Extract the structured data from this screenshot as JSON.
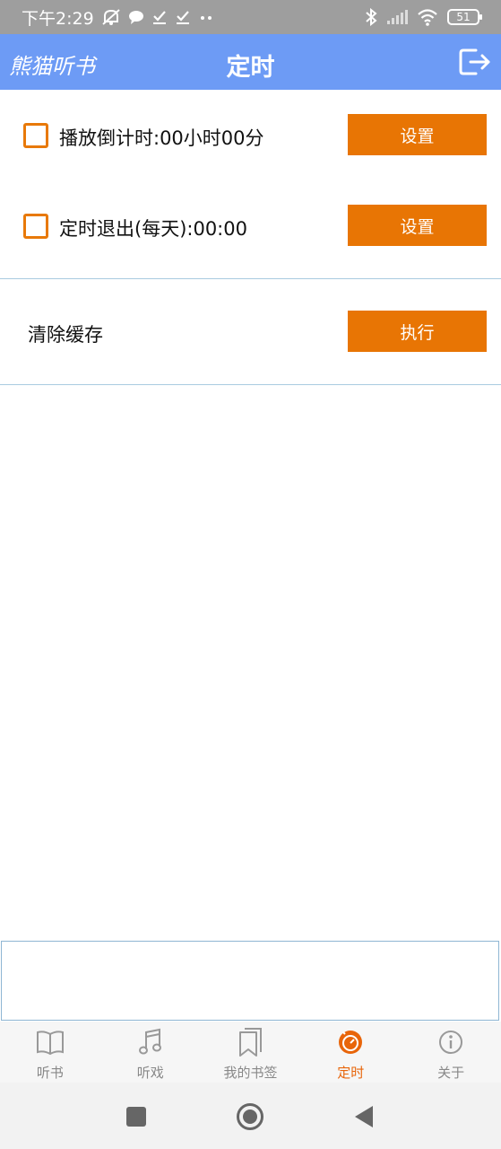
{
  "status_bar": {
    "time": "下午2:29",
    "battery": "51",
    "icons": [
      "mute-icon",
      "chat-bubble-icon",
      "download-done-icon",
      "download-done-icon",
      "more-dots-icon",
      "bluetooth-icon",
      "signal-icon",
      "wifi-icon",
      "battery-icon"
    ]
  },
  "header": {
    "brand": "熊猫听书",
    "title": "定时",
    "exit_icon": "exit-icon"
  },
  "settings": {
    "countdown": {
      "label": "播放倒计时:00小时00分",
      "button": "设置",
      "checked": false
    },
    "daily_exit": {
      "label": "定时退出(每天):00:00",
      "button": "设置",
      "checked": false
    },
    "clear_cache": {
      "label": "清除缓存",
      "button": "执行"
    }
  },
  "bottom_nav": {
    "items": [
      {
        "label": "听书",
        "icon": "book-icon",
        "active": false
      },
      {
        "label": "听戏",
        "icon": "music-note-icon",
        "active": false
      },
      {
        "label": "我的书签",
        "icon": "bookmark-icon",
        "active": false
      },
      {
        "label": "定时",
        "icon": "timer-icon",
        "active": true
      },
      {
        "label": "关于",
        "icon": "info-icon",
        "active": false
      }
    ]
  },
  "colors": {
    "header_bg": "#6d9bf5",
    "accent_orange": "#e87504",
    "active_nav": "#e8650a"
  }
}
